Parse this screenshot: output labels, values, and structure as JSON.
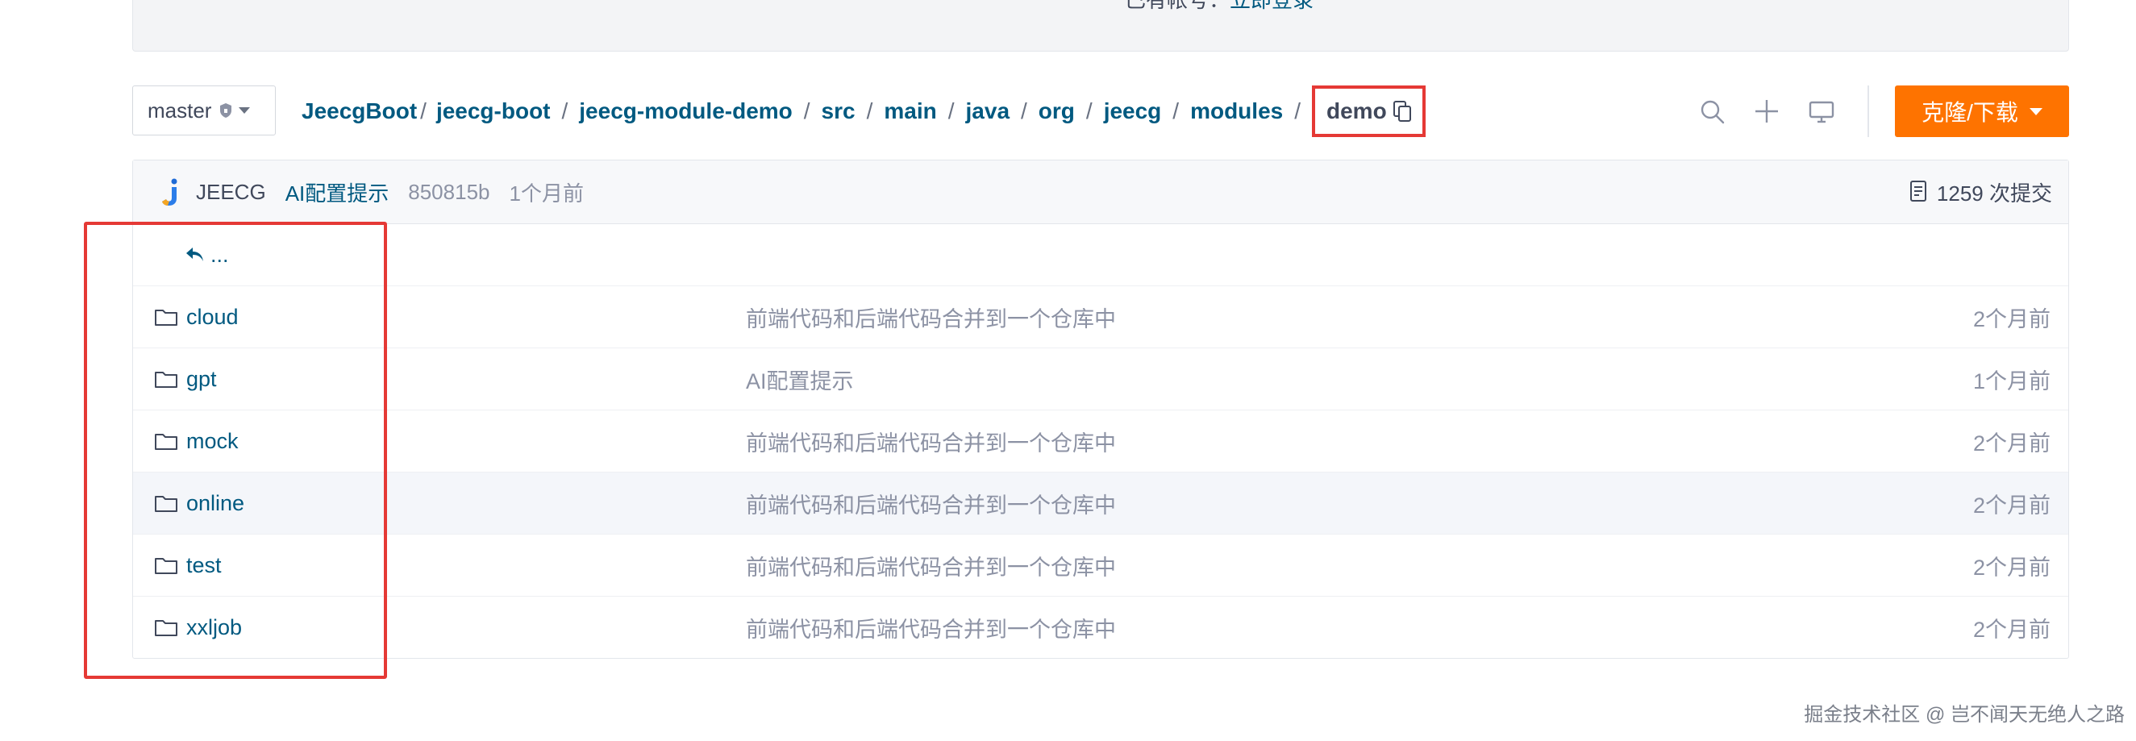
{
  "top_banner": {
    "text_prefix": "已有帐号：",
    "login_link": "立即登录"
  },
  "branch": {
    "name": "master"
  },
  "breadcrumb": {
    "items": [
      "JeecgBoot",
      "jeecg-boot",
      "jeecg-module-demo",
      "src",
      "main",
      "java",
      "org",
      "jeecg",
      "modules"
    ],
    "separator": "/",
    "current": "demo"
  },
  "actions": {
    "clone_label": "克隆/下载"
  },
  "commit": {
    "author": "JEECG",
    "message": "AI配置提示",
    "hash": "850815b",
    "time": "1个月前",
    "count": "1259 次提交"
  },
  "files": {
    "parent_label": "...",
    "rows": [
      {
        "name": "cloud",
        "message": "前端代码和后端代码合并到一个仓库中",
        "time": "2个月前"
      },
      {
        "name": "gpt",
        "message": "AI配置提示",
        "time": "1个月前"
      },
      {
        "name": "mock",
        "message": "前端代码和后端代码合并到一个仓库中",
        "time": "2个月前"
      },
      {
        "name": "online",
        "message": "前端代码和后端代码合并到一个仓库中",
        "time": "2个月前"
      },
      {
        "name": "test",
        "message": "前端代码和后端代码合并到一个仓库中",
        "time": "2个月前"
      },
      {
        "name": "xxljob",
        "message": "前端代码和后端代码合并到一个仓库中",
        "time": "2个月前"
      }
    ]
  },
  "watermark": "掘金技术社区 @ 岂不闻天无绝人之路",
  "colors": {
    "link": "#005980",
    "accent": "#fe7300",
    "annotation": "#e53935"
  }
}
